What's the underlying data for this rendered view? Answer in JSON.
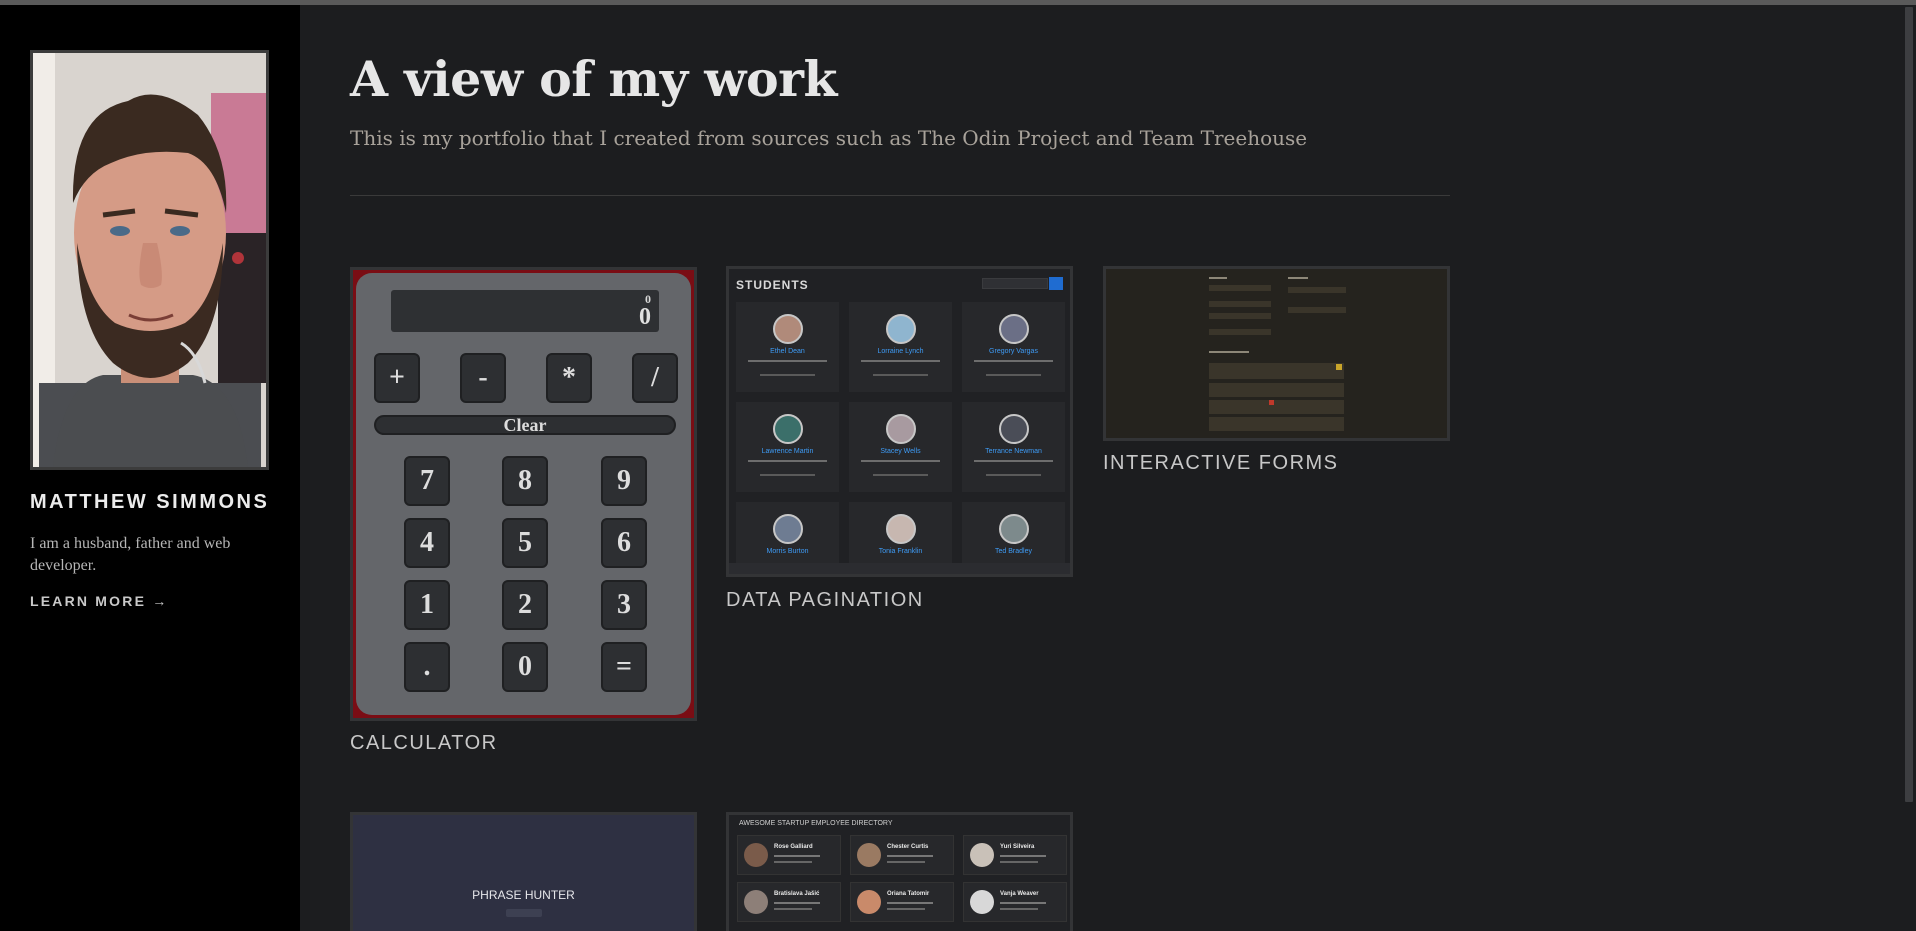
{
  "sidebar": {
    "name": "MATTHEW SIMMONS",
    "description": "I am a husband, father and web developer.",
    "link": "LEARN MORE →"
  },
  "main": {
    "title": "A view of my work",
    "subtitle": "This is my portfolio that I created from sources such as The Odin Project and Team Treehouse"
  },
  "projects": [
    {
      "label": "CALCULATOR",
      "display_previous": "0",
      "display_current": "0",
      "operators": [
        "+",
        "-",
        "*",
        "/"
      ],
      "clear": "Clear",
      "keys": [
        "7",
        "8",
        "9",
        "4",
        "5",
        "6",
        "1",
        "2",
        "3",
        ".",
        "0",
        "="
      ]
    },
    {
      "label": "DATA PAGINATION",
      "header": "STUDENTS",
      "students": [
        "Ethel Dean",
        "Lorraine Lynch",
        "Gregory Vargas",
        "Lawrence Martin",
        "Stacey Wells",
        "Terrance Newman",
        "Morris Burton",
        "Tonia Franklin",
        "Ted Bradley"
      ]
    },
    {
      "label": "INTERACTIVE FORMS"
    },
    {
      "label": "",
      "title": "PHRASE HUNTER"
    },
    {
      "label": "",
      "header": "AWESOME STARTUP EMPLOYEE DIRECTORY",
      "employees": [
        "Rose Galliard",
        "Chester Curtis",
        "Yuri Silveira",
        "Bratislava Jašić",
        "Oriana Tatomir",
        "Vanja Weaver"
      ]
    }
  ],
  "colors": {
    "page_bg": "#1c1d1f",
    "sidebar_bg": "#000000",
    "student_name": "#3e9bf5",
    "calc_frame": "#7a0d14"
  }
}
